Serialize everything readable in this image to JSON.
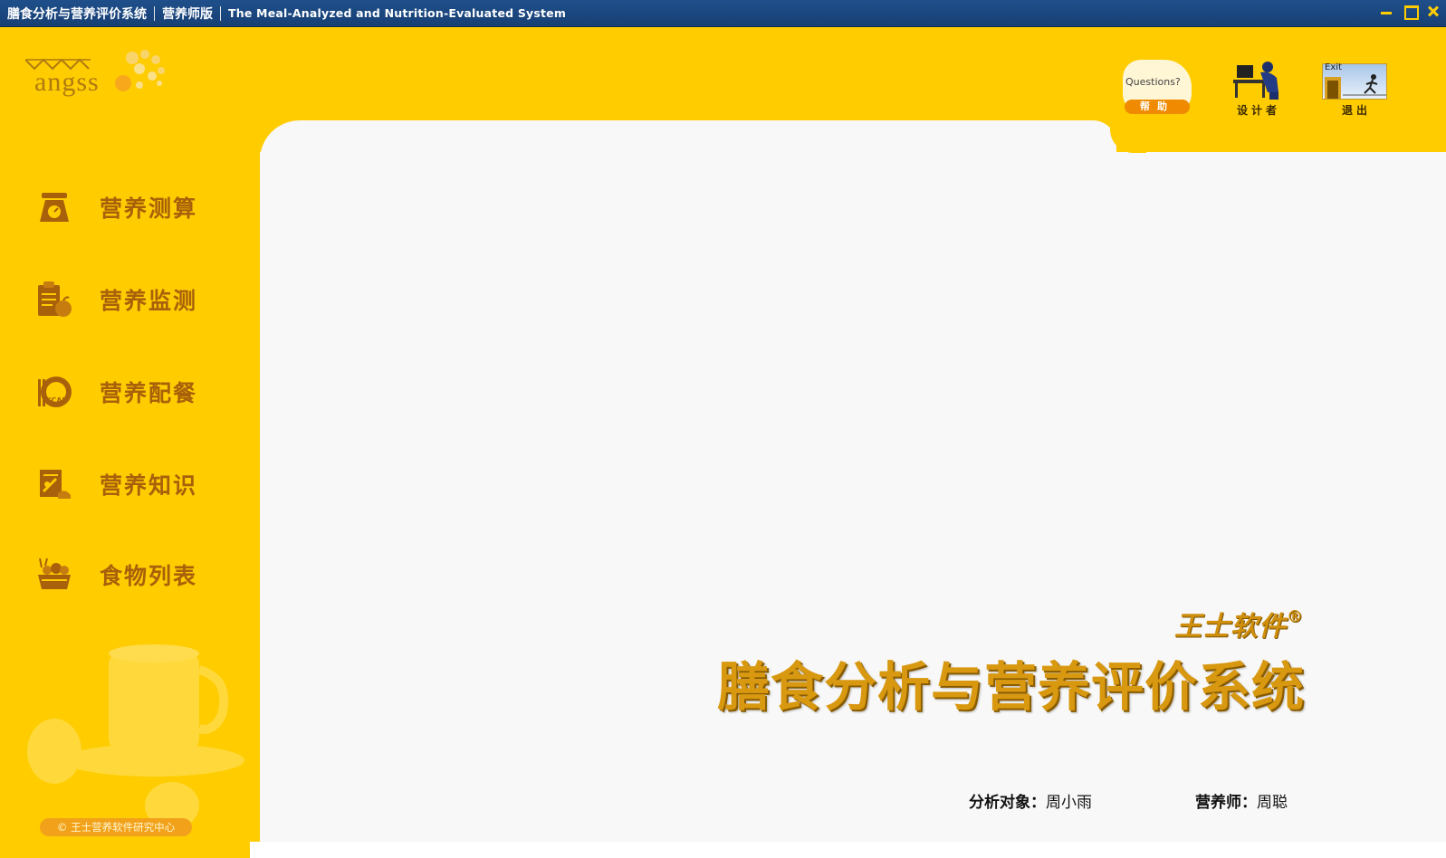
{
  "titlebar": {
    "app_name": "膳食分析与营养评价系统",
    "edition": "营养师版",
    "english_name": "The Meal-Analyzed and Nutrition-Evaluated System"
  },
  "logo": {
    "text": "angss"
  },
  "tools": {
    "help": {
      "caption": "Questions?",
      "label": "帮助"
    },
    "designer": {
      "label": "设计者"
    },
    "exit": {
      "caption": "Exit",
      "label": "退出"
    }
  },
  "sidebar": {
    "items": [
      {
        "label": "营养测算",
        "icon": "scale-icon"
      },
      {
        "label": "营养监测",
        "icon": "clipboard-apple-icon"
      },
      {
        "label": "营养配餐",
        "icon": "kcal-meal-icon"
      },
      {
        "label": "营养知识",
        "icon": "book-knowledge-icon"
      },
      {
        "label": "食物列表",
        "icon": "food-basket-icon"
      }
    ],
    "copyright": "© 王士营养软件研究中心"
  },
  "main": {
    "brand": "王士软件",
    "registered": "®",
    "system_title": "膳食分析与营养评价系统",
    "subject_label": "分析对象：",
    "subject_value": "周小雨",
    "dietitian_label": "营养师：",
    "dietitian_value": "周聪"
  },
  "colors": {
    "background": "#ffcc00",
    "titlebar": "#1f4f8a",
    "panel": "#f8f8f8",
    "menu_text": "#a8600a",
    "title_text": "#d89810"
  }
}
